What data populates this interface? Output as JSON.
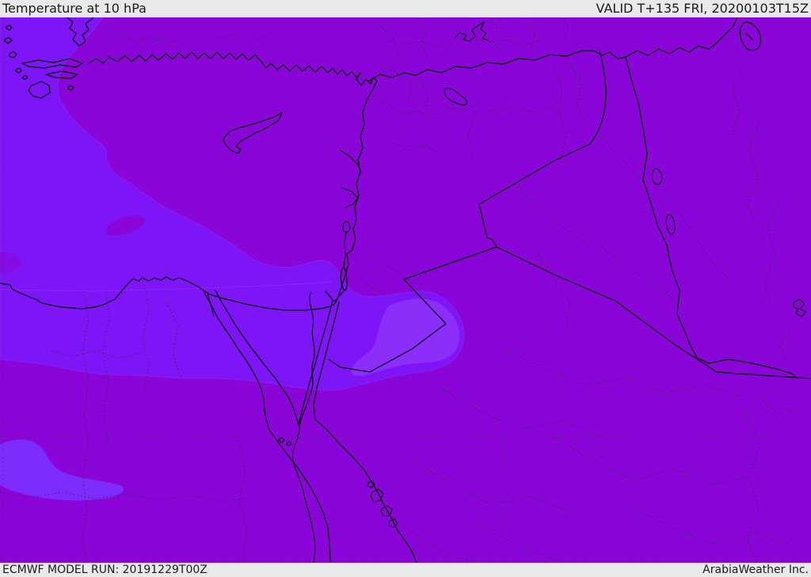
{
  "header": {
    "title": "Temperature at 10 hPa",
    "valid_label": "VALID T+135 FRI, 20200103T15Z"
  },
  "footer": {
    "model_run_label": "ECMWF MODEL RUN: 20191229T00Z",
    "credit_label": "ArabiaWeather Inc."
  },
  "map": {
    "palette": {
      "band_dark": "#8A05D8",
      "band_bright": "#7D15F6",
      "band_brightest_sw": "#7E2BFD",
      "band_brightest_center": "#8C2EFA",
      "contour_edge": "#A43CFF",
      "line_solid": "#000000",
      "line_admin": "#2E2E2E",
      "line_graticule": "#3A3A3A",
      "bar_background": "#E9E9E9",
      "bar_text": "#1B1B1B"
    }
  }
}
